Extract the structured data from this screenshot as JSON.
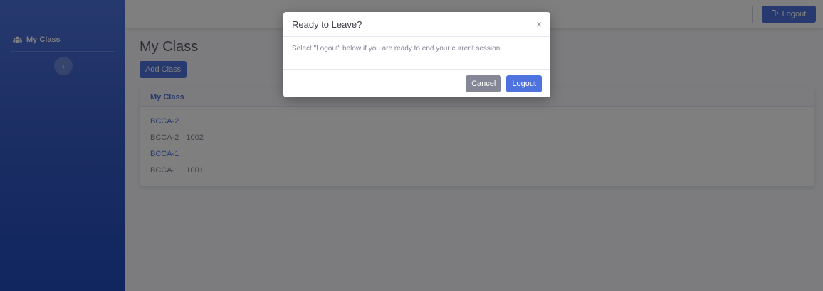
{
  "sidebar": {
    "items": [
      {
        "label": "My Class",
        "icon": "users-icon"
      }
    ],
    "toggle_icon": "‹"
  },
  "topbar": {
    "logout_label": "Logout",
    "logout_icon": "sign-out-icon"
  },
  "main": {
    "title": "My Class",
    "add_button": "Add Class",
    "card": {
      "title": "My Class",
      "classes": [
        {
          "name": "BCCA-2",
          "label": "BCCA-2",
          "code": "1002"
        },
        {
          "name": "BCCA-1",
          "label": "BCCA-1",
          "code": "1001"
        }
      ]
    }
  },
  "modal": {
    "title": "Ready to Leave?",
    "close": "×",
    "body": "Select \"Logout\" below if you are ready to end your current session.",
    "cancel": "Cancel",
    "confirm": "Logout"
  },
  "colors": {
    "primary": "#4e73df",
    "secondary": "#858796",
    "sidebar_dark": "#224abe"
  }
}
